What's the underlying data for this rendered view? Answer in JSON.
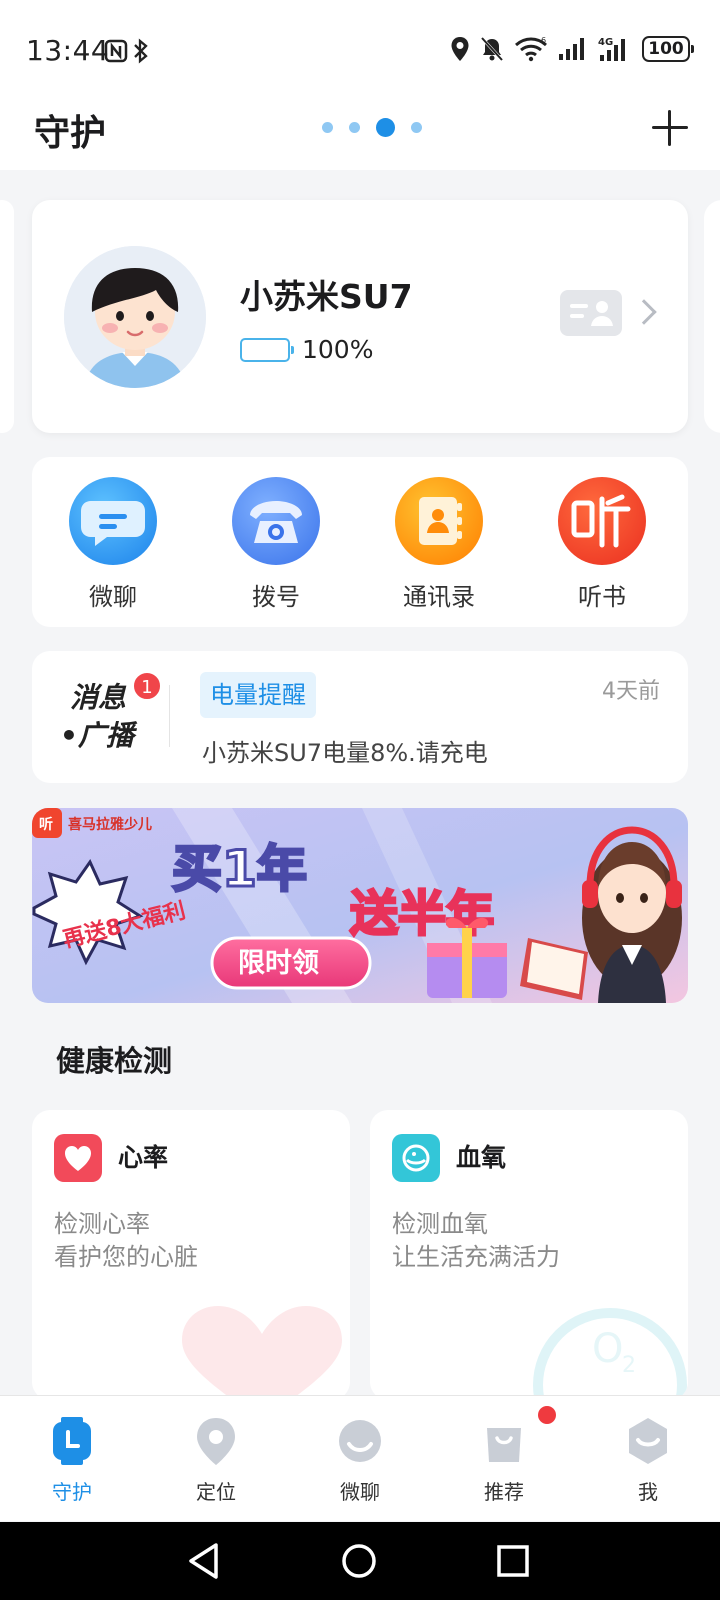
{
  "status_bar": {
    "time": "13:44",
    "battery": "100",
    "network": "4G"
  },
  "header": {
    "title": "守护",
    "page_dots": 4,
    "active_dot": 3
  },
  "device": {
    "name": "小苏米SU7",
    "battery_text": "100%",
    "battery_level": 1.0
  },
  "quick_actions": [
    {
      "label": "微聊",
      "icon": "chat-icon",
      "color": "#2b8ff0"
    },
    {
      "label": "拨号",
      "icon": "telephone-icon",
      "color": "#4a86f0"
    },
    {
      "label": "通讯录",
      "icon": "contacts-book-icon",
      "color": "#ff8c0a"
    },
    {
      "label": "听书",
      "icon": "audiobook-icon",
      "color": "#f2442e"
    }
  ],
  "message": {
    "title_line1": "消息",
    "title_line2": "•广播",
    "badge": "1",
    "tag": "电量提醒",
    "time": "4天前",
    "body": "小苏米SU7电量8%.请充电"
  },
  "banner": {
    "brand": "喜马拉雅少儿",
    "headline_1": "买1年",
    "headline_2": "送半年",
    "burst": "再送8大福利",
    "cta": "限时领"
  },
  "health": {
    "section_title": "健康检测",
    "items": [
      {
        "name": "心率",
        "desc_line1": "检测心率",
        "desc_line2": "看护您的心脏",
        "icon": "heart-icon",
        "color": "#f24a5a"
      },
      {
        "name": "血氧",
        "desc_line1": "检测血氧",
        "desc_line2": "让生活充满活力",
        "icon": "oxygen-icon",
        "color": "#33c6d8"
      }
    ]
  },
  "tabs": [
    {
      "label": "守护",
      "icon": "watch-icon",
      "active": true
    },
    {
      "label": "定位",
      "icon": "location-pin-icon",
      "active": false
    },
    {
      "label": "微聊",
      "icon": "chat-bubble-icon",
      "active": false
    },
    {
      "label": "推荐",
      "icon": "shopping-bag-icon",
      "active": false
    },
    {
      "label": "我",
      "icon": "profile-icon",
      "active": false
    }
  ],
  "colors": {
    "accent": "#1e8fe6",
    "notification_red": "#ef3a3f"
  }
}
